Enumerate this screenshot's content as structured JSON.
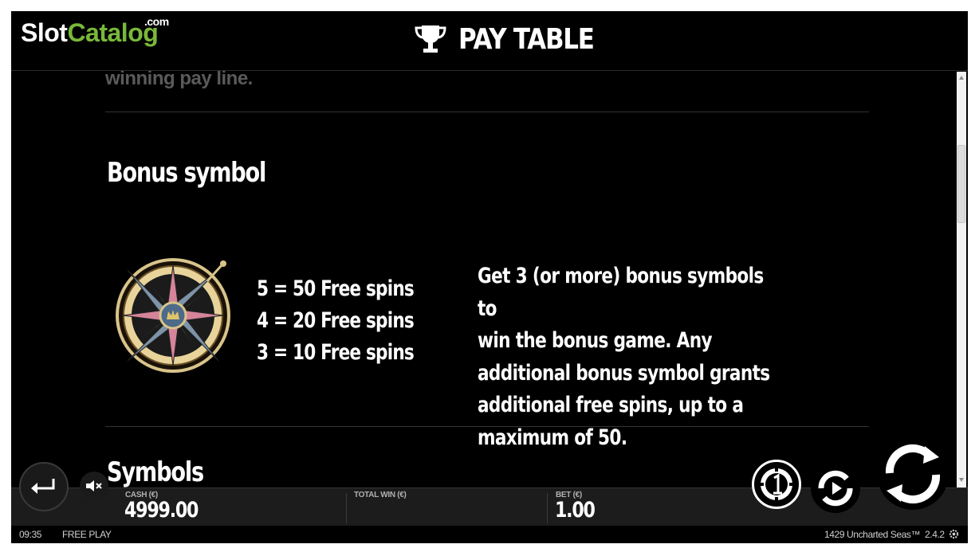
{
  "branding": {
    "slot": "Slot",
    "catalog": "Catalog",
    "com": ".com",
    "catalog_color": "#79b83a"
  },
  "header": {
    "title": "PAY TABLE",
    "icon": "trophy-icon"
  },
  "content": {
    "faded_previous_text": "winning pay line.",
    "bonus_section": {
      "title": "Bonus symbol",
      "symbol_icon": "compass-rose-icon",
      "payouts": [
        "5 = 50 Free spins",
        "4 = 20 Free spins",
        "3 = 10 Free spins"
      ],
      "description_lines": [
        "Get 3 (or more) bonus symbols to",
        "win the bonus game. Any",
        "additional bonus symbol grants",
        "additional free spins, up to a",
        "maximum of 50."
      ]
    },
    "next_section_title": "Symbols"
  },
  "bottom_bar": {
    "cash_label": "CASH (€)",
    "cash_value": "4999.00",
    "total_win_label": "TOTAL WIN (€)",
    "bet_label": "BET (€)",
    "bet_value": "1.00"
  },
  "status_bar": {
    "time": "09:35",
    "mode": "FREE PLAY",
    "game_name": "1429 Uncharted Seas™",
    "version": "2.4.2"
  },
  "controls": {
    "back_icon": "return-arrow-icon",
    "sound_icon": "speaker-muted-icon",
    "coin_icon": "coin-one-icon",
    "autoplay_icon": "autoplay-icon",
    "spin_icon": "spin-arrows-icon",
    "settings_icon": "gear-icon"
  }
}
